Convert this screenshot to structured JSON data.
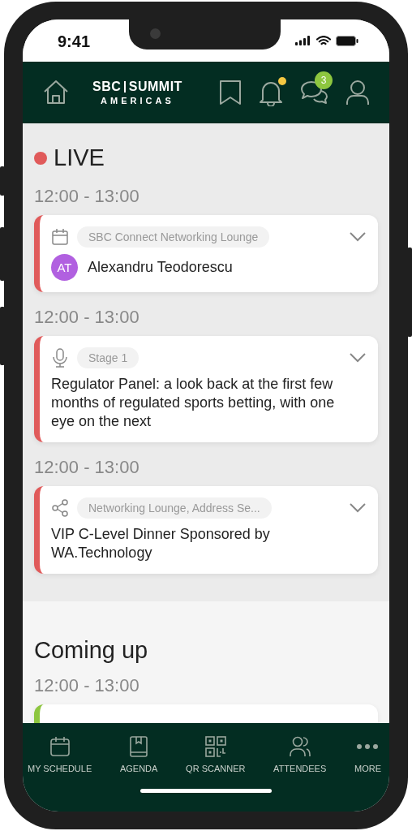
{
  "status_bar": {
    "time": "9:41"
  },
  "header": {
    "logo": {
      "left": "SBC",
      "right": "SUMMIT",
      "sub": "AMERICAS"
    },
    "notifications": {
      "unread": true
    },
    "messages": {
      "badge": "3"
    }
  },
  "live": {
    "title": "LIVE",
    "sessions": [
      {
        "time": "12:00 - 13:00",
        "color": "#e05a5a",
        "kind": "speaker",
        "location": "SBC Connect Networking Lounge",
        "initials": "AT",
        "name": "Alexandru Teodorescu"
      },
      {
        "time": "12:00 - 13:00",
        "color": "#e05a5a",
        "kind": "talk",
        "location": "Stage 1",
        "title": "Regulator Panel: a look back at the first few months of regulated sports betting, with one eye on the next"
      },
      {
        "time": "12:00 - 13:00",
        "color": "#e05a5a",
        "kind": "talk",
        "location": "Networking Lounge, Address Se...",
        "title": "VIP C-Level Dinner Sponsored by WA.Technology"
      }
    ]
  },
  "coming_up": {
    "title": "Coming up",
    "sessions": [
      {
        "time": "12:00 - 13:00",
        "color": "#8dc63f"
      }
    ]
  },
  "bottom_nav": [
    {
      "label": "MY SCHEDULE"
    },
    {
      "label": "AGENDA"
    },
    {
      "label": "QR SCANNER"
    },
    {
      "label": "ATTENDEES"
    },
    {
      "label": "MORE"
    }
  ]
}
